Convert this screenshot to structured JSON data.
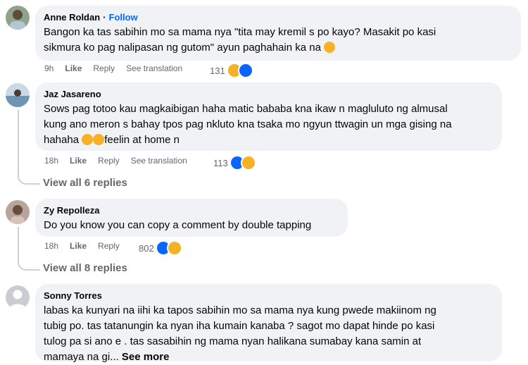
{
  "comments": [
    {
      "author": "Anne Roldan",
      "separator": "·",
      "follow": "Follow",
      "lines": [
        "Bangon ka tas sabihin mo sa mama nya \"tita may kremil s po kayo? Masakit po kasi",
        "sikmura ko pag nalipasan ng gutom\" ayun paghahain ka na"
      ],
      "time": "9h",
      "like": "Like",
      "reply": "Reply",
      "translate": "See translation",
      "reactions": "131"
    },
    {
      "author": "Jaz Jasareno",
      "lines": [
        "Sows pag totoo kau magkaibigan haha matic bababa kna ikaw n magluluto ng almusal",
        "kung ano meron s bahay tpos pag nkluto kna tsaka mo ngyun ttwagin un mga gising na",
        "hahaha",
        "feelin at home n"
      ],
      "time": "18h",
      "like": "Like",
      "reply": "Reply",
      "translate": "See translation",
      "reactions": "113",
      "view_replies": "View all 6 replies"
    },
    {
      "author": "Zy Repolleza",
      "lines": [
        "Do you know you can copy a comment by double tapping"
      ],
      "time": "18h",
      "like": "Like",
      "reply": "Reply",
      "reactions": "802",
      "view_replies": "View all 8 replies"
    },
    {
      "author": "Sonny Torres",
      "lines": [
        "labas ka kunyari na iihi ka tapos sabihin mo sa mama nya kung pwede makiinom ng",
        "tubig po. tas tatanungin ka nyan iha kumain kanaba ? sagot mo dapat hinde po kasi",
        "tulog pa si ano e . tas sasabihin ng mama nyan halikana sumabay kana samin at",
        "mamaya na gi...",
        "See more"
      ]
    }
  ],
  "colors": {
    "bubble": "#f0f2f5",
    "secondary": "#65676b",
    "link": "#0866ff"
  },
  "icons": [
    "laughing-emoji-icon",
    "like-reaction-icon",
    "default-avatar-icon"
  ]
}
